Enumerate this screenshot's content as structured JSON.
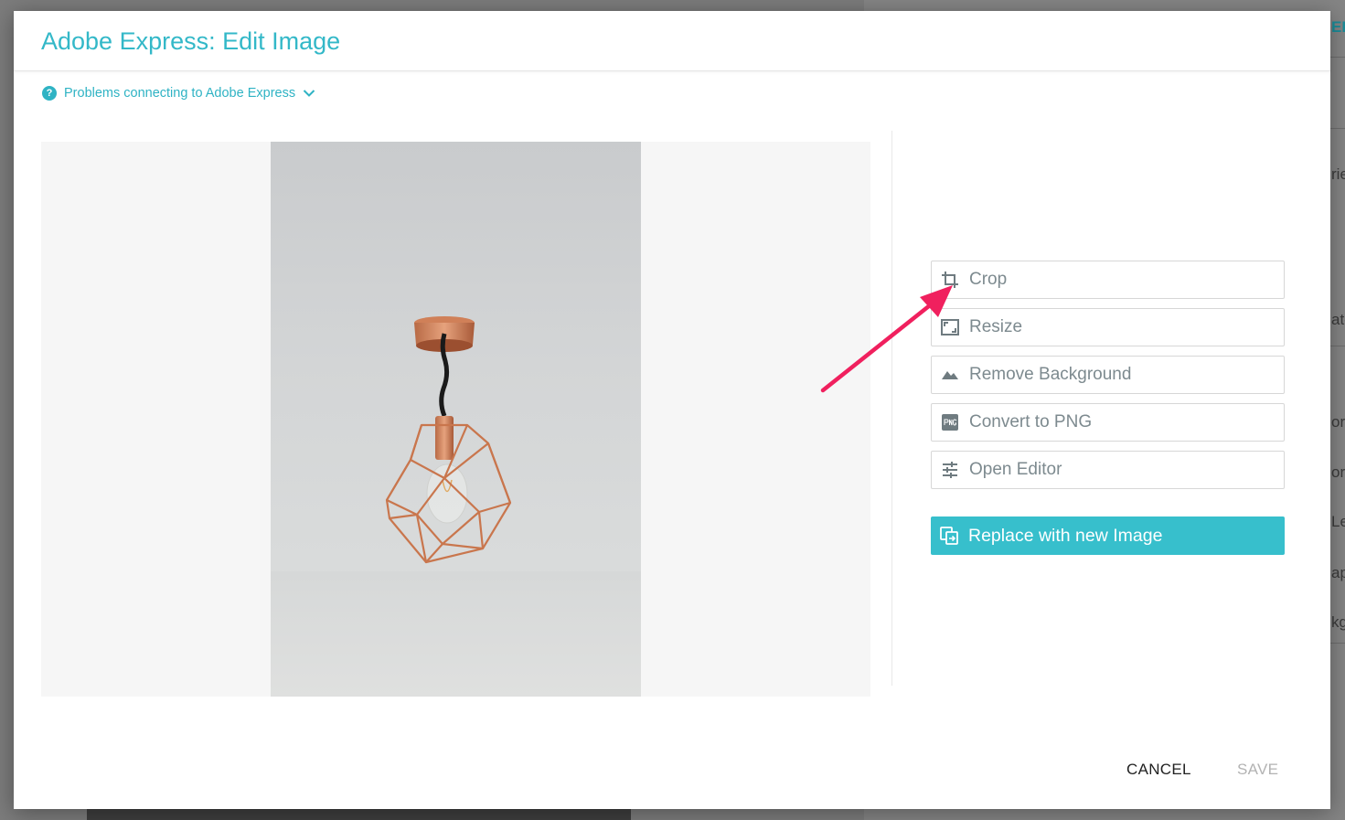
{
  "dialog": {
    "title": "Adobe Express: Edit Image",
    "help_link": "Problems connecting to Adobe Express"
  },
  "tools": [
    {
      "label": "Crop",
      "icon": "crop-icon"
    },
    {
      "label": "Resize",
      "icon": "resize-icon"
    },
    {
      "label": "Remove Background",
      "icon": "mountain-icon"
    },
    {
      "label": "Convert to PNG",
      "icon": "png-icon"
    },
    {
      "label": "Open Editor",
      "icon": "sliders-icon"
    }
  ],
  "replace_button": {
    "label": "Replace with new Image",
    "icon": "replace-image-icon"
  },
  "footer": {
    "cancel_label": "CANCEL",
    "save_label": "SAVE"
  },
  "backdrop_fragments": [
    "EF",
    "rie",
    "ate",
    "or",
    "or",
    "Le",
    "ap",
    "kgi"
  ],
  "colors": {
    "accent": "#33b8c8",
    "arrow": "#f0205e"
  }
}
